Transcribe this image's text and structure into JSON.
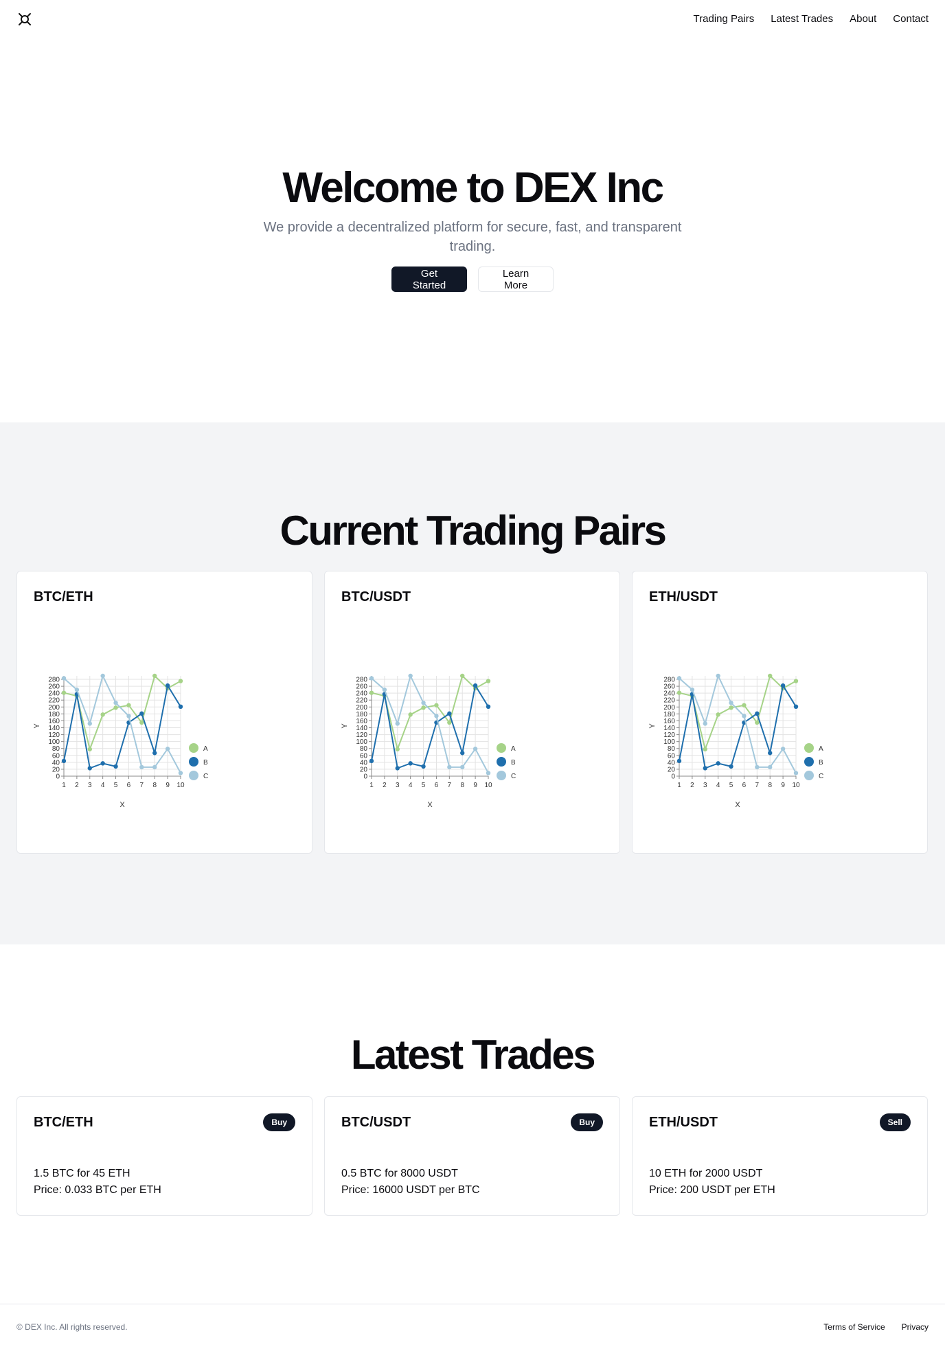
{
  "nav": {
    "logo_icon": "quad-arrows-logo-icon",
    "items": [
      "Trading Pairs",
      "Latest Trades",
      "About",
      "Contact"
    ]
  },
  "hero": {
    "title": "Welcome to DEX Inc",
    "subtitle": "We provide a decentralized platform for secure, fast, and transparent trading.",
    "primary_button": "Get Started",
    "secondary_button": "Learn More"
  },
  "pairs_section": {
    "title": "Current Trading Pairs",
    "cards": [
      {
        "title": "BTC/ETH"
      },
      {
        "title": "BTC/USDT"
      },
      {
        "title": "ETH/USDT"
      }
    ]
  },
  "chart_data": [
    {
      "type": "line",
      "x": [
        1,
        2,
        3,
        4,
        5,
        6,
        7,
        8,
        9,
        10
      ],
      "xlabel": "X",
      "ylabel": "Y",
      "yticks": [
        0,
        20,
        40,
        60,
        80,
        100,
        120,
        140,
        160,
        180,
        200,
        220,
        240,
        260,
        280
      ],
      "ylim": [
        0,
        290
      ],
      "grid": true,
      "legend": "right",
      "series": [
        {
          "name": "A",
          "color": "#a6d388",
          "values": [
            241,
            232,
            78,
            178,
            198,
            205,
            155,
            290,
            254,
            275
          ]
        },
        {
          "name": "B",
          "color": "#1f6fad",
          "values": [
            44,
            237,
            23,
            37,
            28,
            155,
            181,
            67,
            262,
            201
          ]
        },
        {
          "name": "C",
          "color": "#a3c8dc",
          "values": [
            283,
            250,
            152,
            290,
            212,
            174,
            26,
            26,
            79,
            9
          ]
        }
      ]
    },
    {
      "type": "line",
      "x": [
        1,
        2,
        3,
        4,
        5,
        6,
        7,
        8,
        9,
        10
      ],
      "xlabel": "X",
      "ylabel": "Y",
      "yticks": [
        0,
        20,
        40,
        60,
        80,
        100,
        120,
        140,
        160,
        180,
        200,
        220,
        240,
        260,
        280
      ],
      "ylim": [
        0,
        290
      ],
      "grid": true,
      "legend": "right",
      "series": [
        {
          "name": "A",
          "color": "#a6d388",
          "values": [
            241,
            232,
            78,
            178,
            198,
            205,
            155,
            290,
            254,
            275
          ]
        },
        {
          "name": "B",
          "color": "#1f6fad",
          "values": [
            44,
            237,
            23,
            37,
            28,
            155,
            181,
            67,
            262,
            201
          ]
        },
        {
          "name": "C",
          "color": "#a3c8dc",
          "values": [
            283,
            250,
            152,
            290,
            212,
            174,
            26,
            26,
            79,
            9
          ]
        }
      ]
    },
    {
      "type": "line",
      "x": [
        1,
        2,
        3,
        4,
        5,
        6,
        7,
        8,
        9,
        10
      ],
      "xlabel": "X",
      "ylabel": "Y",
      "yticks": [
        0,
        20,
        40,
        60,
        80,
        100,
        120,
        140,
        160,
        180,
        200,
        220,
        240,
        260,
        280
      ],
      "ylim": [
        0,
        290
      ],
      "grid": true,
      "legend": "right",
      "series": [
        {
          "name": "A",
          "color": "#a6d388",
          "values": [
            241,
            232,
            78,
            178,
            198,
            205,
            155,
            290,
            254,
            275
          ]
        },
        {
          "name": "B",
          "color": "#1f6fad",
          "values": [
            44,
            237,
            23,
            37,
            28,
            155,
            181,
            67,
            262,
            201
          ]
        },
        {
          "name": "C",
          "color": "#a3c8dc",
          "values": [
            283,
            250,
            152,
            290,
            212,
            174,
            26,
            26,
            79,
            9
          ]
        }
      ]
    }
  ],
  "trades_section": {
    "title": "Latest Trades",
    "cards": [
      {
        "pair": "BTC/ETH",
        "side": "Buy",
        "amount": "1.5 BTC for 45 ETH",
        "price": "Price: 0.033 BTC per ETH"
      },
      {
        "pair": "BTC/USDT",
        "side": "Buy",
        "amount": "0.5 BTC for 8000 USDT",
        "price": "Price: 16000 USDT per BTC"
      },
      {
        "pair": "ETH/USDT",
        "side": "Sell",
        "amount": "10 ETH for 2000 USDT",
        "price": "Price: 200 USDT per ETH"
      }
    ]
  },
  "footer": {
    "copyright": "© DEX Inc. All rights reserved.",
    "links": [
      "Terms of Service",
      "Privacy"
    ]
  },
  "colors": {
    "primary_dark": "#111827",
    "muted_text": "#6b7280",
    "section_bg": "#f3f4f6"
  }
}
